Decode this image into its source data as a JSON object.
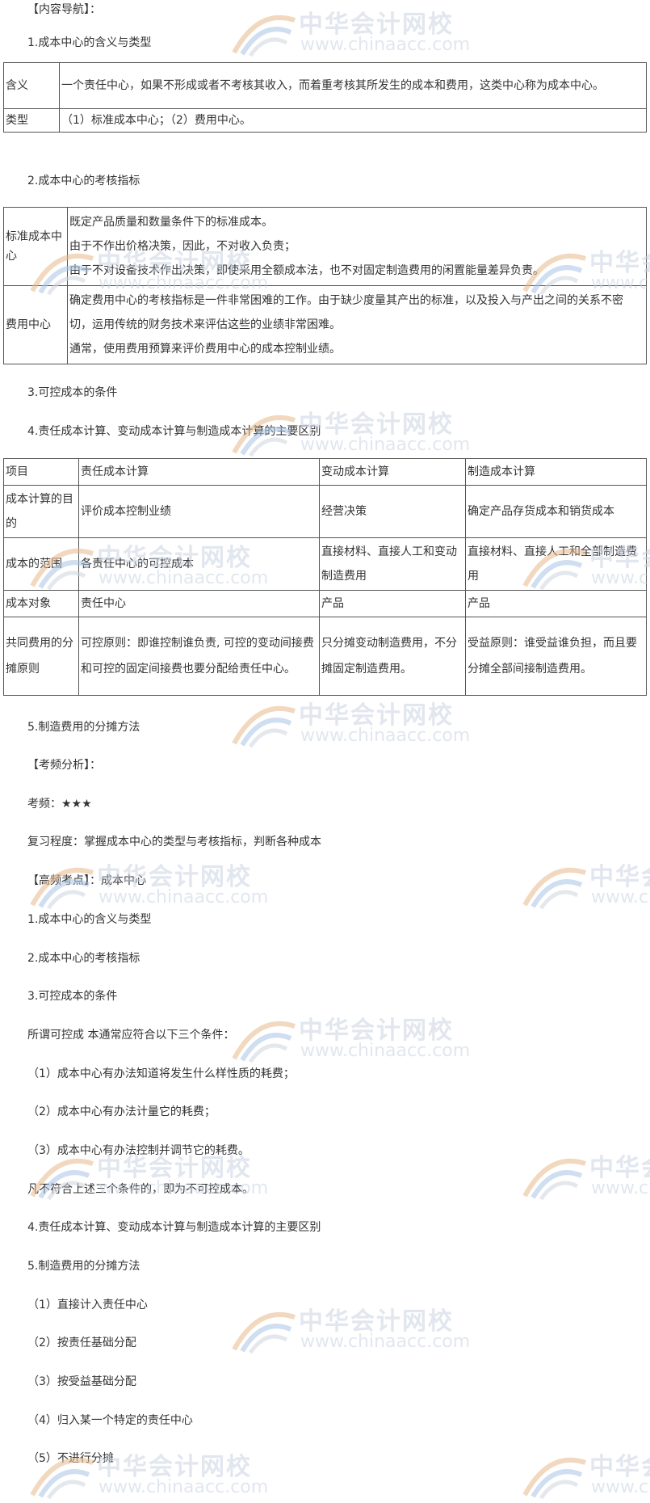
{
  "nav_heading": "【内容导航】：",
  "section1_title": "1.成本中心的含义与类型",
  "table1": {
    "rows": [
      {
        "label": "含义",
        "content": "一个责任中心，如果不形成或者不考核其收入，而着重考核其所发生的成本和费用，这类中心称为成本中心。"
      },
      {
        "label": "类型",
        "content": "（1）标准成本中心；（2）费用中心。"
      }
    ]
  },
  "section2_title": "2.成本中心的考核指标",
  "table2": {
    "rows": [
      {
        "label": "标准成本中心",
        "lines": [
          "既定产品质量和数量条件下的标准成本。",
          "由于不作出价格决策，因此，不对收入负责；",
          "由于不对设备技术作出决策，即使采用全额成本法，也不对固定制造费用的闲置能量差异负责。"
        ]
      },
      {
        "label": "费用中心",
        "lines": [
          "确定费用中心的考核指标是一件非常困难的工作。由于缺少度量其产出的标准，以及投入与产出之间的关系不密切，运用传统的财务技术来评估这些的业绩非常困难。",
          "通常，使用费用预算来评价费用中心的成本控制业绩。"
        ]
      }
    ]
  },
  "section3_title": "3.可控成本的条件",
  "section4_title": "4.责任成本计算、变动成本计算与制造成本计算的主要区别",
  "table3": {
    "headers": [
      "项目",
      "责任成本计算",
      "变动成本计算",
      "制造成本计算"
    ],
    "rows": [
      [
        "成本计算的目的",
        "评价成本控制业绩",
        "经营决策",
        "确定产品存货成本和销货成本"
      ],
      [
        "成本的范围",
        "各责任中心的可控成本",
        "直接材料、直接人工和变动制造费用",
        "直接材料、直接人工和全部制造费用"
      ],
      [
        "成本对象",
        "责任中心",
        "产品",
        "产品"
      ],
      [
        "共同费用的分摊原则",
        "可控原则：即谁控制谁负责, 可控的变动间接费和可控的固定间接费也要分配给责任中心。",
        "只分摊变动制造费用，不分摊固定制造费用。",
        "受益原则：谁受益谁负担，而且要分摊全部间接制造费用。"
      ]
    ]
  },
  "section5_title": "5.制造费用的分摊方法",
  "freq_heading": "【考频分析】：",
  "freq_label": "考频：★★★",
  "review_level": "复习程度：掌握成本中心的类型与考核指标，判断各种成本",
  "hot_heading": "【高频考点】：成本中心",
  "hot_items": [
    "1.成本中心的含义与类型",
    "2.成本中心的考核指标",
    "3.可控成本的条件"
  ],
  "controllable_intro": "所谓可控成 本通常应符合以下三个条件：",
  "conditions": [
    "（1）成本中心有办法知道将发生什么样性质的耗费；",
    "（2）成本中心有办法计量它的耗费；",
    "（3）成本中心有办法控制并调节它的耗费。"
  ],
  "non_controllable": "凡不符合上述三个条件的，即为不可控成本。",
  "hot_items_2": [
    "4.责任成本计算、变动成本计算与制造成本计算的主要区别",
    "5.制造费用的分摊方法"
  ],
  "methods": [
    "（1）直接计入责任中心",
    "（2）按责任基础分配",
    "（3）按受益基础分配",
    "（4）归入某一个特定的责任中心",
    "（5）不进行分摊"
  ],
  "watermark": {
    "cn": "中华会计网校",
    "url": "www.chinaacc.com"
  }
}
